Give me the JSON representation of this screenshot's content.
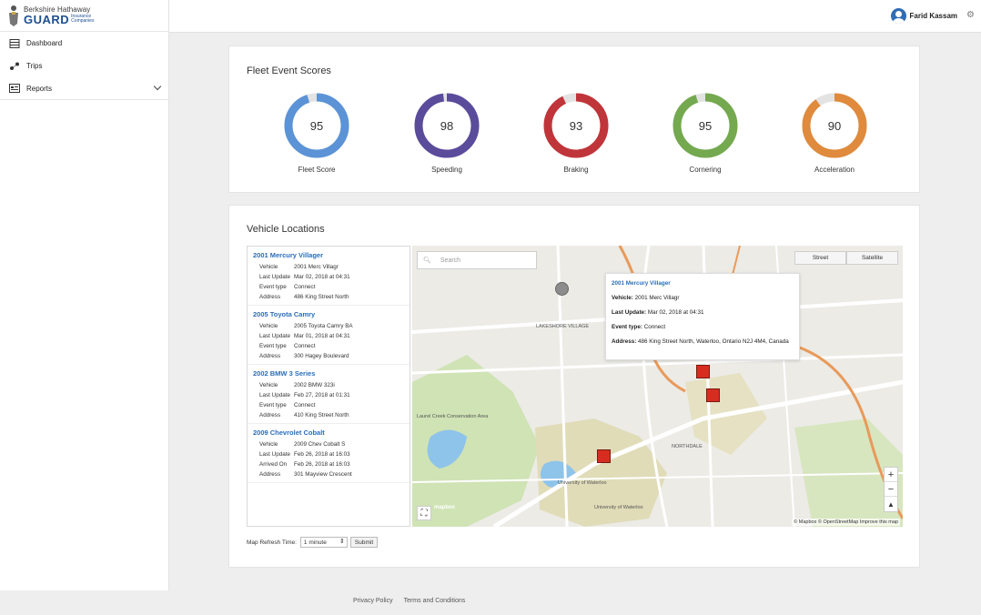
{
  "brand": {
    "top": "Berkshire Hathaway",
    "main": "GUARD",
    "sub": "Insurance Companies"
  },
  "sidebar": {
    "items": [
      {
        "label": "Dashboard",
        "icon": "dashboard-icon"
      },
      {
        "label": "Trips",
        "icon": "trips-icon"
      },
      {
        "label": "Reports",
        "icon": "reports-icon"
      }
    ]
  },
  "header": {
    "user_name": "Farid Kassam"
  },
  "scores": {
    "title": "Fleet Event Scores",
    "items": [
      {
        "label": "Fleet Score",
        "value": "95",
        "percent": 95,
        "color": "#5b93d6"
      },
      {
        "label": "Speeding",
        "value": "98",
        "percent": 98,
        "color": "#5b4b9b"
      },
      {
        "label": "Braking",
        "value": "93",
        "percent": 93,
        "color": "#c0353a"
      },
      {
        "label": "Cornering",
        "value": "95",
        "percent": 95,
        "color": "#74a94f"
      },
      {
        "label": "Acceleration",
        "value": "90",
        "percent": 90,
        "color": "#df8a3c"
      }
    ]
  },
  "locations": {
    "title": "Vehicle Locations",
    "vehicles": [
      {
        "name": "2001 Mercury Villager",
        "rows": [
          {
            "k": "Vehicle",
            "v": "2001 Merc Villagr"
          },
          {
            "k": "Last Update",
            "v": "Mar 02, 2018 at 04:31"
          },
          {
            "k": "Event type",
            "v": "Connect"
          },
          {
            "k": "Address",
            "v": "486 King Street North"
          }
        ]
      },
      {
        "name": "2005 Toyota Camry",
        "rows": [
          {
            "k": "Vehicle",
            "v": "2005 Toyota Camry BA"
          },
          {
            "k": "Last Update",
            "v": "Mar 01, 2018 at 04:31"
          },
          {
            "k": "Event type",
            "v": "Connect"
          },
          {
            "k": "Address",
            "v": "300 Hagey Boulevard"
          }
        ]
      },
      {
        "name": "2002 BMW 3 Series",
        "rows": [
          {
            "k": "Vehicle",
            "v": "2002 BMW 323i"
          },
          {
            "k": "Last Update",
            "v": "Feb 27, 2018 at 01:31"
          },
          {
            "k": "Event type",
            "v": "Connect"
          },
          {
            "k": "Address",
            "v": "410 King Street North"
          }
        ]
      },
      {
        "name": "2009 Chevrolet Cobalt",
        "rows": [
          {
            "k": "Vehicle",
            "v": "2009 Chev Cobalt S"
          },
          {
            "k": "Last Update",
            "v": "Feb 26, 2018 at 16:03"
          },
          {
            "k": "Arrived On",
            "v": "Feb 26, 2018 at 16:03"
          },
          {
            "k": "Address",
            "v": "301 Mayview Crescent"
          }
        ]
      }
    ],
    "map": {
      "search_placeholder": "Search",
      "type_street": "Street",
      "type_satellite": "Satellite",
      "popup": {
        "name": "2001 Mercury Villager",
        "vehicle_label": "Vehicle:",
        "vehicle": "2001 Merc Villagr",
        "update_label": "Last Update:",
        "update": "Mar 02, 2018 at 04:31",
        "event_label": "Event type:",
        "event": "Connect",
        "address_label": "Address:",
        "address": "486 King Street North, Waterloo, Ontario N2J 4M4, Canada"
      },
      "labels": {
        "village": "LAKESHORE VILLAGE",
        "park": "Laurel Creek Conservation Area",
        "university": "University of Waterloo",
        "univ2": "University of Waterloo",
        "northdale": "NORTHDALE",
        "logo": "mapbox"
      },
      "zoom_in": "+",
      "zoom_out": "−",
      "compass": "▲",
      "fullscreen": "⛶",
      "attribution": "© Mapbox © OpenStreetMap Improve this map"
    },
    "refresh_label": "Map Refresh Time:",
    "refresh_value": "1 minute",
    "submit_label": "Submit"
  },
  "footer": {
    "privacy": "Privacy Policy",
    "terms": "Terms and Conditions"
  }
}
